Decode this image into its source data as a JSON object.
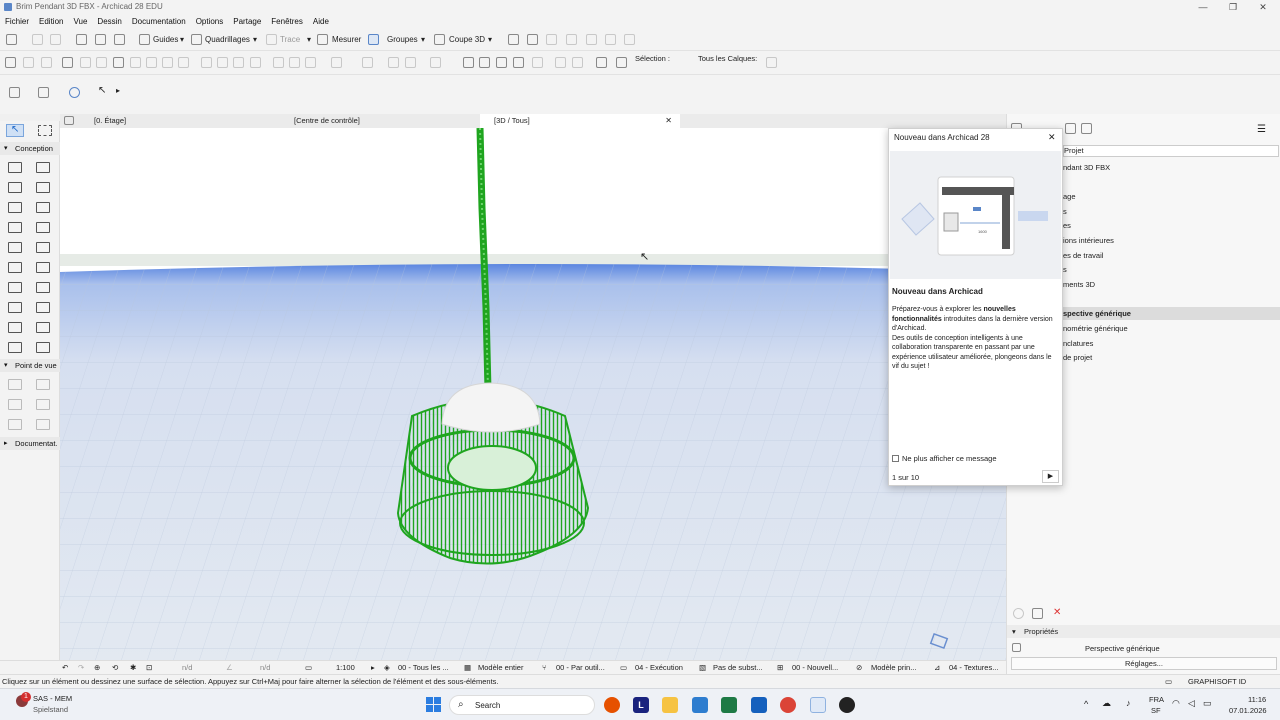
{
  "window": {
    "title": "Brim Pendant 3D FBX - Archicad 28 EDU"
  },
  "menu": [
    "Fichier",
    "Edition",
    "Vue",
    "Dessin",
    "Documentation",
    "Options",
    "Partage",
    "Fenêtres",
    "Aide"
  ],
  "toolbar1": {
    "guides": "Guides",
    "quadrillages": "Quadrillages",
    "trace": "Trace",
    "mesurer": "Mesurer",
    "groupes": "Groupes",
    "coupe3d": "Coupe 3D"
  },
  "toolbar2": {
    "selection": "Sélection :",
    "calques": "Tous les Calques:"
  },
  "tabs": [
    {
      "label": "[0. Étage]"
    },
    {
      "label": "[Centre de contrôle]"
    },
    {
      "label": "[3D / Tous]"
    }
  ],
  "leftpanel": {
    "conception": "Conception",
    "pointdevue": "Point de vue",
    "documentation": "Documentat."
  },
  "popup": {
    "header": "Nouveau dans Archicad 28",
    "title": "Nouveau dans Archicad",
    "p1a": "Préparez-vous à explorer les ",
    "p1b": "nouvelles fonctionnalités",
    "p1c": " introduites dans la dernière version d'Archicad.",
    "p2": "Des outils de conception intelligents à une collaboration transparente en passant par une expérience utilisateur améliorée, plongeons dans le vif du sujet !",
    "checkbox": "Ne plus afficher ce message",
    "pager": "1 sur 10",
    "illus_label": "1600"
  },
  "navigator": {
    "search": "Projet",
    "items": [
      "ndant 3D FBX",
      "",
      "age",
      "s",
      "es",
      "ions intérieures",
      "es de travail",
      "s",
      "ments 3D"
    ],
    "items2": [
      "spective générique",
      "nométrie générique",
      "nclatures",
      " de projet"
    ]
  },
  "properties": {
    "header": "Propriétés",
    "value": "Perspective générique",
    "button": "Réglages..."
  },
  "statusbar": {
    "nd1": "n/d",
    "nd2": "n/d",
    "scale": "1:100",
    "layers": "00 - Tous les ...",
    "model": "Modèle entier",
    "pen": "00 - Par outil...",
    "mvo": "04 - Exécution",
    "subst": "Pas de subst...",
    "reno": "00 - Nouvell...",
    "dim": "Modèle prin...",
    "tex": "04 - Textures..."
  },
  "hint": "Cliquez sur un élément ou dessinez une surface de sélection. Appuyez sur Ctrl+Maj pour faire alterner la sélection de l'élément et des sous-éléments.",
  "graphisoft": "GRAPHISOFT ID",
  "taskbar": {
    "notif_count": "1",
    "app1": "SAS - MEM",
    "app2": "Spielstand",
    "search": "Search",
    "lang1": "FRA",
    "lang2": "SF",
    "time": "11:16",
    "date": "07.01.2026"
  },
  "colors": {
    "lamp": "#1fa51f",
    "horizon": "#5b86e0",
    "accent": "#1a66c8"
  }
}
